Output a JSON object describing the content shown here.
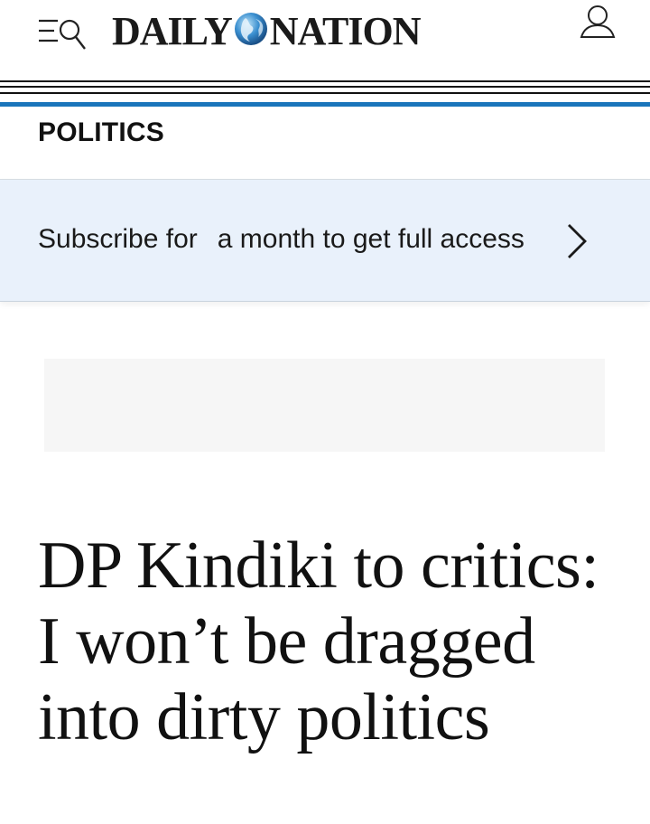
{
  "header": {
    "logo_left": "DAILY",
    "logo_right": "NATION"
  },
  "section": {
    "label": "POLITICS"
  },
  "subscribe": {
    "text_before": "Subscribe for",
    "text_after": "a month to get full access"
  },
  "article": {
    "headline": "DP Kindiki to critics: I won’t be dragged into dirty politics"
  },
  "colors": {
    "accent_blue": "#1a75bb",
    "subscribe_bg": "#e9f1fb",
    "ad_bg": "#f6f6f6"
  },
  "icons": {
    "menu": "menu-icon",
    "search": "search-icon",
    "logo_globe": "globe-icon",
    "account": "user-icon",
    "subscribe_arrow": "chevron-right-icon"
  }
}
